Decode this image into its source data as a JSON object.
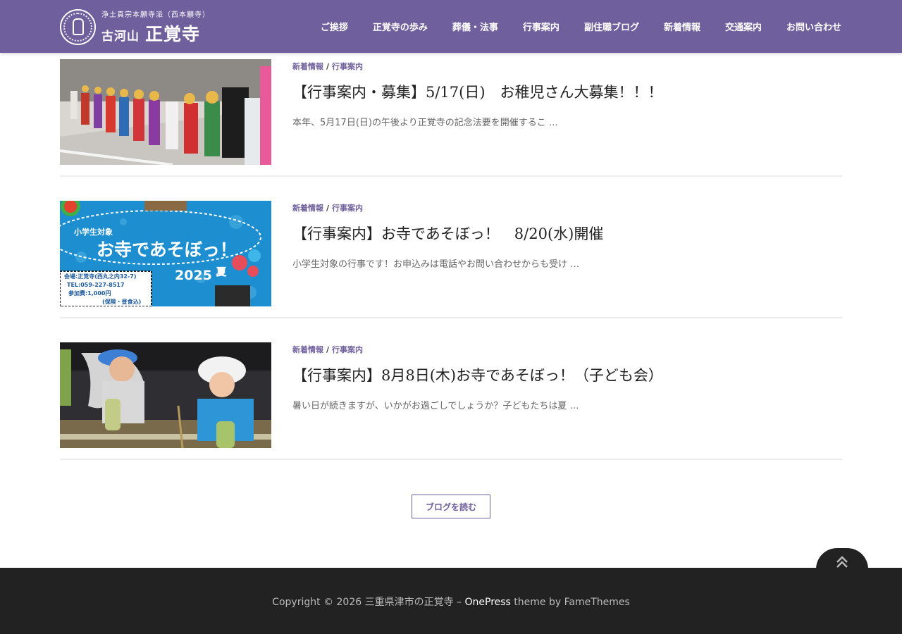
{
  "header": {
    "logo": {
      "subtitle": "浄土真宗本願寺派（西本願寺）",
      "mountain": "古河山",
      "temple": "正覚寺"
    },
    "nav": [
      "ご挨拶",
      "正覚寺の歩み",
      "葬儀・法事",
      "行事案内",
      "副住職ブログ",
      "新着情報",
      "交通案内",
      "お問い合わせ"
    ]
  },
  "posts": [
    {
      "categories": [
        "新着情報",
        "行事案内"
      ],
      "title": "【行事案内・募集】5/17(日)　お稚児さん大募集！！！",
      "excerpt": "本年、5月17日(日)の午後より正覚寺の記念法要を開催するこ …"
    },
    {
      "categories": [
        "新着情報",
        "行事案内"
      ],
      "title": "【行事案内】お寺であそぼっ！　8/20(水)開催",
      "excerpt": "小学生対象の行事です！お申込みは電話やお問い合わせからも受け …",
      "flyer": {
        "target": "小学生対象",
        "headline": "お寺であそぼっ！",
        "year": "2025",
        "season": "夏",
        "venue": "会場:正覚寺(西丸之内32-7)",
        "tel": "TEL:059-227-8517",
        "fee": "参加費:1,000円",
        "fee_note": "(保険・昼食込)"
      }
    },
    {
      "categories": [
        "新着情報",
        "行事案内"
      ],
      "title": "【行事案内】8月8日(木)お寺であそぼっ！（子ども会）",
      "excerpt": "暑い日が続きますが、いかがお過ごしでしょうか？子どもたちは夏 …"
    }
  ],
  "read_blog_label": "ブログを読む",
  "footer": {
    "copyright_prefix": "Copyright © 2026 三重県津市の正覚寺 – ",
    "theme_name": "OnePress",
    "theme_suffix": " theme by FameThemes"
  },
  "icons": {
    "back_to_top": "double-chevron-up-icon"
  },
  "colors": {
    "brand": "#6f5f9c",
    "footer": "#222222"
  }
}
